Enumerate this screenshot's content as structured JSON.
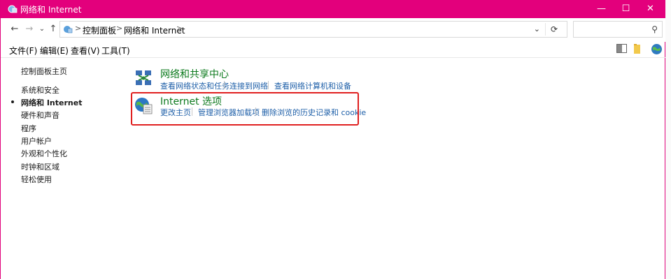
{
  "window": {
    "title": "网络和 Internet"
  },
  "titlebar_controls": {
    "minimize": "—",
    "maximize": "☐",
    "close": "✕"
  },
  "nav": {
    "back": "←",
    "forward": "→",
    "recent": "⌄",
    "up": "↑"
  },
  "address": {
    "crumbs": [
      "控制面板",
      "网络和 Internet"
    ],
    "separator": ">",
    "dropdown": "⌄",
    "refresh": "⟳"
  },
  "search": {
    "placeholder": "",
    "icon": "search-icon",
    "glyph": "⚲"
  },
  "menu": {
    "file": "文件(F)",
    "edit": "编辑(E)",
    "view": "查看(V)",
    "tools": "工具(T)"
  },
  "sidebar": {
    "items": [
      {
        "label": "控制面板主页"
      },
      {
        "label": "系统和安全"
      },
      {
        "label": "网络和 Internet",
        "active": true
      },
      {
        "label": "硬件和声音"
      },
      {
        "label": "程序"
      },
      {
        "label": "用户帐户"
      },
      {
        "label": "外观和个性化"
      },
      {
        "label": "时钟和区域"
      },
      {
        "label": "轻松使用"
      }
    ]
  },
  "categories": [
    {
      "title": "网络和共享中心",
      "icon": "network-sharing-icon",
      "links": [
        "查看网络状态和任务",
        "连接到网络",
        "查看网络计算机和设备"
      ]
    },
    {
      "title": "Internet 选项",
      "icon": "internet-options-icon",
      "links": [
        "更改主页",
        "管理浏览器加载项",
        "删除浏览的历史记录和 cookie"
      ]
    }
  ],
  "colors": {
    "titlebar": "#e3007c",
    "category_title": "#0c7a1d",
    "link": "#1e5fa8",
    "highlight_border": "#e02020"
  }
}
